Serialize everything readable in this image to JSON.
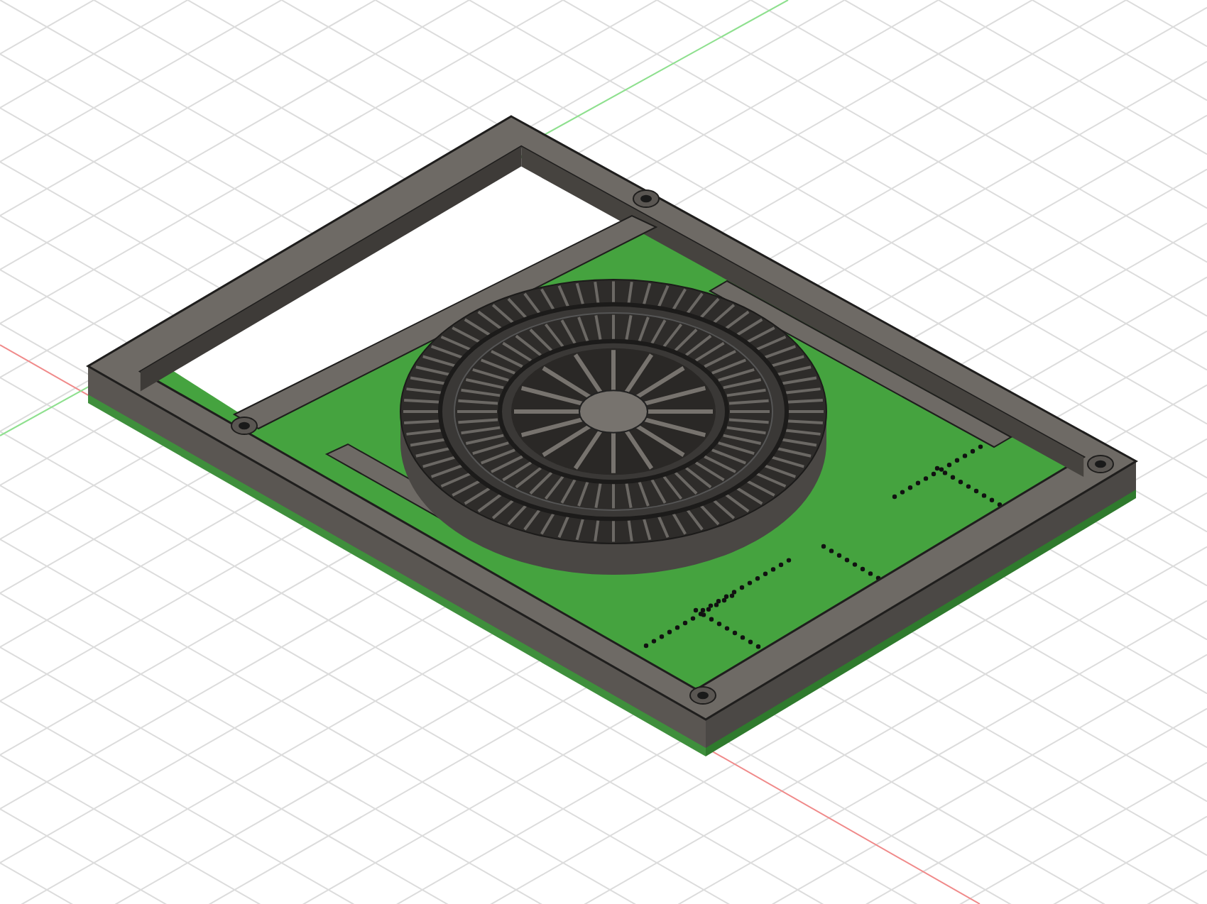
{
  "viewport": {
    "grid": true,
    "axes": true
  },
  "model": {
    "kind": "pcb-enclosure"
  }
}
